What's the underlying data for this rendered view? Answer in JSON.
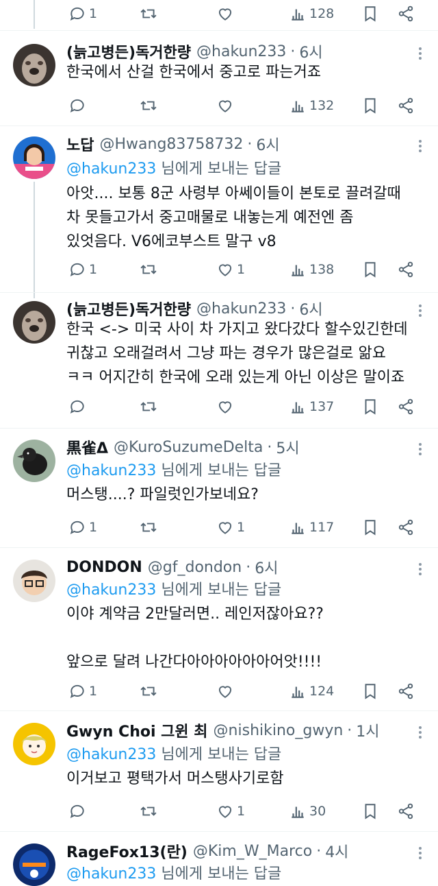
{
  "top_actions": {
    "reply_count": "1",
    "view_count": "128"
  },
  "reply_prefix_suffix": "님에게 보내는 답글",
  "tweets": [
    {
      "name": "(늙고병든)독거한량",
      "handle": "@hakun233",
      "time": "6시",
      "reply_to": "",
      "lines": [
        "한국에서 산걸 한국에서 중고로 파는거죠"
      ],
      "reply_count": "",
      "like_count": "",
      "view_count": "132"
    },
    {
      "name": "노답",
      "handle": "@Hwang83758732",
      "time": "6시",
      "reply_to": "@hakun233",
      "lines": [
        "아앗.... 보통 8군 사령부 아쎄이들이 본토로 끌려갈때",
        "차 못들고가서 중고매물로 내놓는게 예전엔 좀",
        "있엇음다. V6에코부스트 말구 v8"
      ],
      "reply_count": "1",
      "like_count": "1",
      "view_count": "138"
    },
    {
      "name": "(늙고병든)독거한량",
      "handle": "@hakun233",
      "time": "6시",
      "reply_to": "",
      "lines": [
        "한국 <-> 미국 사이 차 가지고 왔다갔다 할수있긴한데",
        "귀찮고 오래걸려서 그냥 파는 경우가 많은걸로 앎요",
        "ㅋㅋ 어지간히 한국에 오래 있는게 아닌 이상은 말이죠"
      ],
      "reply_count": "",
      "like_count": "",
      "view_count": "137"
    },
    {
      "name": "黒雀Δ",
      "handle": "@KuroSuzumeDelta",
      "time": "5시",
      "reply_to": "@hakun233",
      "lines": [
        "머스탱....? 파일럿인가보네요?"
      ],
      "reply_count": "1",
      "like_count": "1",
      "view_count": "117"
    },
    {
      "name": "DONDON",
      "handle": "@gf_dondon",
      "time": "6시",
      "reply_to": "@hakun233",
      "lines": [
        "이야 계약금 2만달러면.. 레인저잖아요??",
        "",
        "앞으로 달려 나간다아아아아아아어앗!!!!"
      ],
      "reply_count": "1",
      "like_count": "",
      "view_count": "124"
    },
    {
      "name": "Gwyn Choi 그윈 최",
      "handle": "@nishikino_gwyn",
      "time": "1시",
      "reply_to": "@hakun233",
      "lines": [
        "이거보고 평택가서 머스탱사기로함"
      ],
      "reply_count": "",
      "like_count": "1",
      "view_count": "30"
    },
    {
      "name": "RageFox13(란)",
      "handle": "@Kim_W_Marco",
      "time": "4시",
      "reply_to": "@hakun233",
      "lines": [],
      "reply_count": "",
      "like_count": "",
      "view_count": ""
    }
  ]
}
